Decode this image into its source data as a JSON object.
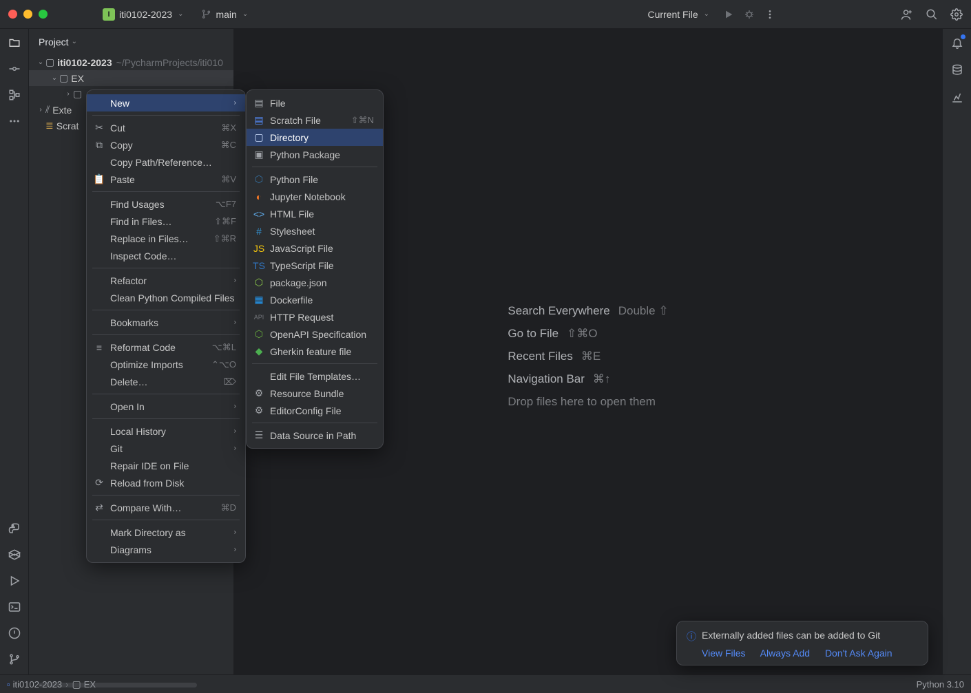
{
  "titlebar": {
    "projectBadge": "I",
    "projectName": "iti0102-2023",
    "branchName": "main",
    "runConfig": "Current File"
  },
  "projectPane": {
    "title": "Project",
    "root": "iti0102-2023",
    "rootPath": "~/PycharmProjects/iti010",
    "folder1": "EX",
    "extLib": "Exte",
    "scratch": "Scrat"
  },
  "ctx1": {
    "new": "New",
    "cut": "Cut",
    "cutSc": "⌘X",
    "copy": "Copy",
    "copySc": "⌘C",
    "copyPath": "Copy Path/Reference…",
    "paste": "Paste",
    "pasteSc": "⌘V",
    "findUsages": "Find Usages",
    "findUsagesSc": "⌥F7",
    "findInFiles": "Find in Files…",
    "findInFilesSc": "⇧⌘F",
    "replaceInFiles": "Replace in Files…",
    "replaceInFilesSc": "⇧⌘R",
    "inspect": "Inspect Code…",
    "refactor": "Refactor",
    "clean": "Clean Python Compiled Files",
    "bookmarks": "Bookmarks",
    "reformat": "Reformat Code",
    "reformatSc": "⌥⌘L",
    "optimize": "Optimize Imports",
    "optimizeSc": "⌃⌥O",
    "delete": "Delete…",
    "deleteSc": "⌦",
    "openIn": "Open In",
    "localHistory": "Local History",
    "git": "Git",
    "repair": "Repair IDE on File",
    "reload": "Reload from Disk",
    "compare": "Compare With…",
    "compareSc": "⌘D",
    "markDir": "Mark Directory as",
    "diagrams": "Diagrams"
  },
  "ctx2": {
    "file": "File",
    "scratch": "Scratch File",
    "scratchSc": "⇧⌘N",
    "directory": "Directory",
    "pkg": "Python Package",
    "py": "Python File",
    "jupyter": "Jupyter Notebook",
    "html": "HTML File",
    "stylesheet": "Stylesheet",
    "js": "JavaScript File",
    "ts": "TypeScript File",
    "package": "package.json",
    "docker": "Dockerfile",
    "http": "HTTP Request",
    "openapi": "OpenAPI Specification",
    "gherkin": "Gherkin feature file",
    "editTpl": "Edit File Templates…",
    "resBundle": "Resource Bundle",
    "editorconfig": "EditorConfig File",
    "datasource": "Data Source in Path"
  },
  "editorHints": {
    "search": "Search Everywhere",
    "searchSc": "Double ⇧",
    "gotoFile": "Go to File",
    "gotoFileSc": "⇧⌘O",
    "recent": "Recent Files",
    "recentSc": "⌘E",
    "navbar": "Navigation Bar",
    "navbarSc": "⌘↑",
    "drop": "Drop files here to open them"
  },
  "notif": {
    "text": "Externally added files can be added to Git",
    "link1": "View Files",
    "link2": "Always Add",
    "link3": "Don't Ask Again"
  },
  "status": {
    "bc1": "iti0102-2023",
    "bc2": "EX",
    "interp": "Python 3.10"
  }
}
